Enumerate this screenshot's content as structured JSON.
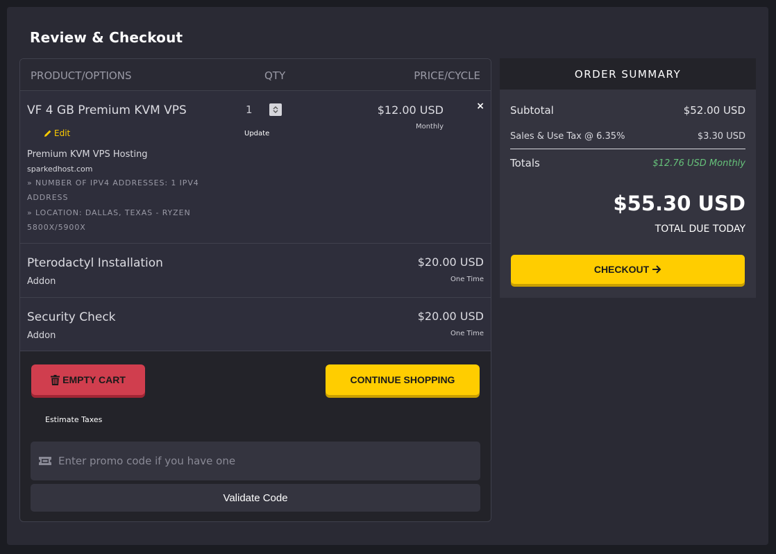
{
  "page": {
    "title": "Review & Checkout"
  },
  "cart": {
    "headers": {
      "product": "PRODUCT/OPTIONS",
      "qty": "QTY",
      "price": "PRICE/CYCLE"
    },
    "items": [
      {
        "name": "VF 4 GB Premium KVM VPS",
        "edit_label": "Edit",
        "description": "Premium KVM VPS Hosting",
        "domain": "sparkedhost.com",
        "options": [
          "» NUMBER OF IPV4 ADDRESSES: 1 IPV4 ADDRESS",
          "» LOCATION: DALLAS, TEXAS - RYZEN 5800X/5900X"
        ],
        "qty": "1",
        "update_label": "Update",
        "price": "$12.00 USD",
        "cycle": "Monthly",
        "remove_label": "×"
      },
      {
        "name": "Pterodactyl Installation",
        "type": "Addon",
        "price": "$20.00 USD",
        "cycle": "One Time"
      },
      {
        "name": "Security Check",
        "type": "Addon",
        "price": "$20.00 USD",
        "cycle": "One Time"
      }
    ],
    "empty_cart_label": "EMPTY CART",
    "continue_shopping_label": "CONTINUE SHOPPING",
    "estimate_taxes_label": "Estimate Taxes",
    "promo_placeholder": "Enter promo code if you have one",
    "validate_label": "Validate Code"
  },
  "summary": {
    "title": "ORDER SUMMARY",
    "subtotal_label": "Subtotal",
    "subtotal_value": "$52.00 USD",
    "tax_label": "Sales & Use Tax @ 6.35%",
    "tax_value": "$3.30 USD",
    "totals_label": "Totals",
    "recurring_value": "$12.76 USD Monthly",
    "total_due": "$55.30 USD",
    "total_due_label": "TOTAL DUE TODAY",
    "checkout_label": "CHECKOUT"
  },
  "colors": {
    "accent": "#ffcd00",
    "danger": "#d03e4e",
    "recurring": "#66c17a",
    "background": "#2a2a34"
  },
  "icons": {
    "edit": "pencil-icon",
    "remove": "close-icon",
    "trash": "trash-icon",
    "ticket": "ticket-icon",
    "arrow": "arrow-right-icon",
    "spinner": "spinner-arrows-icon"
  }
}
